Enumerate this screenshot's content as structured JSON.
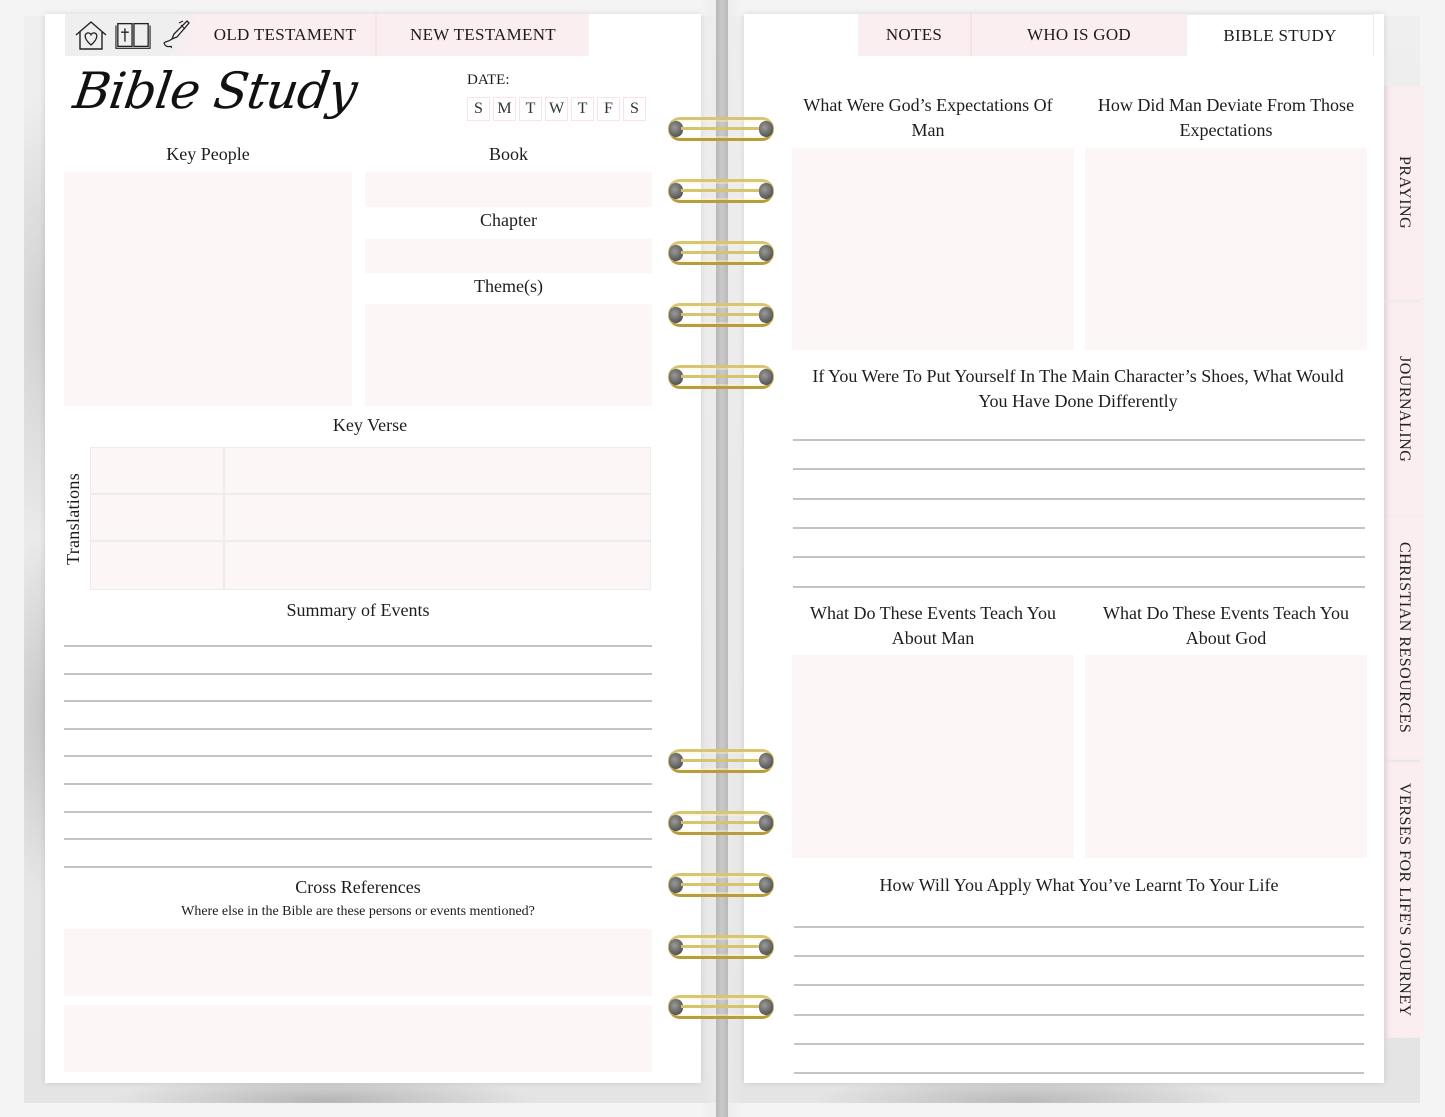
{
  "nav": {
    "icons": [
      "home-heart-icon",
      "bible-icon",
      "pen-icon"
    ],
    "left_tabs": [
      "OLD TESTAMENT",
      "NEW TESTAMENT"
    ],
    "right_tabs": [
      "NOTES",
      "WHO IS GOD",
      "BIBLE STUDY"
    ],
    "active_tab": "BIBLE STUDY",
    "side_tabs": [
      "PRAYING",
      "JOURNALING",
      "CHRISTIAN RESOURCES",
      "VERSES FOR LIFE'S JOURNEY"
    ]
  },
  "left_page": {
    "title": "Bible Study",
    "date_label": "DATE:",
    "days": [
      "S",
      "M",
      "T",
      "W",
      "T",
      "F",
      "S"
    ],
    "key_people_label": "Key People",
    "book_label": "Book",
    "chapter_label": "Chapter",
    "themes_label": "Theme(s)",
    "key_verse_label": "Key Verse",
    "translations_label": "Translations",
    "translation_rows": 3,
    "summary_label": "Summary of Events",
    "summary_lines": 9,
    "cross_ref_label": "Cross References",
    "cross_ref_subtitle": "Where else in the Bible are these persons or events mentioned?"
  },
  "right_page": {
    "q1": "What Were God’s Expectations Of Man",
    "q2": "How Did Man Deviate From Those Expectations",
    "q3": "If You Were To Put Yourself In The Main Character’s Shoes, What Would You Have Done Differently",
    "q3_lines": 6,
    "q4": "What Do These Events Teach You About Man",
    "q5": "What Do These Events Teach You About God",
    "q6": "How Will You Apply What You’ve Learnt To Your Life",
    "q6_lines": 6
  },
  "colors": {
    "tab_pink": "#fbeef0",
    "box_pink": "#fdf6f6",
    "ring_gold": "#c9b15a",
    "rule_gray": "#c4c4c4"
  }
}
